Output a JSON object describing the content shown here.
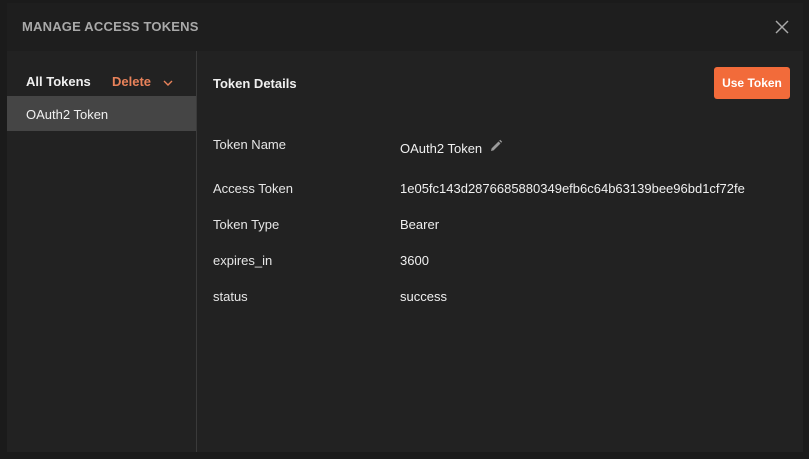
{
  "modal": {
    "title": "MANAGE ACCESS TOKENS",
    "close_icon": "close-icon"
  },
  "sidebar": {
    "header_label": "All Tokens",
    "delete_label": "Delete",
    "delete_icon": "chevron-down-icon",
    "tokens": [
      {
        "label": "OAuth2 Token",
        "selected": true
      }
    ]
  },
  "details": {
    "title": "Token Details",
    "use_button_label": "Use Token",
    "rows": [
      {
        "label": "Token Name",
        "value": "OAuth2 Token",
        "editable": true
      },
      {
        "label": "Access Token",
        "value": "1e05fc143d2876685880349efb6c64b63139bee96bd1cf72fe"
      },
      {
        "label": "Token Type",
        "value": "Bearer"
      },
      {
        "label": "expires_in",
        "value": "3600"
      },
      {
        "label": "status",
        "value": "success"
      }
    ],
    "edit_icon": "pencil-icon"
  },
  "colors": {
    "accent": "#f26b3a",
    "delete": "#e8825a",
    "background": "#222222",
    "header": "#1e1e1e",
    "selected_item": "#454545"
  }
}
